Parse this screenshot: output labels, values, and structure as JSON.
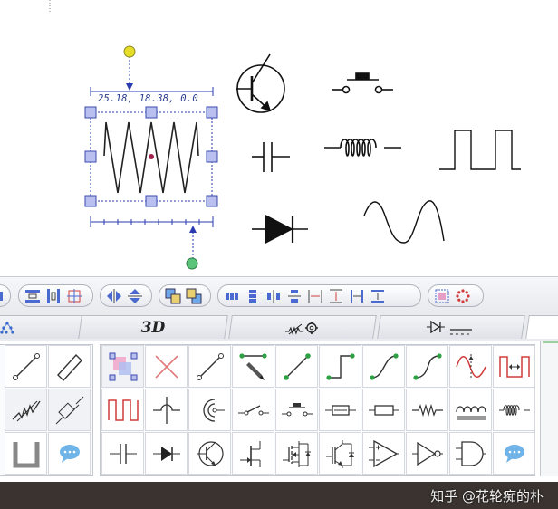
{
  "canvas": {
    "coordinate_readout": "25.18, 18.38, 0.0"
  },
  "tabs": [
    {
      "label": "",
      "icon": "tree-icon"
    },
    {
      "label": "3D",
      "icon": ""
    },
    {
      "label": "",
      "icon": "resistor-gear-icon"
    },
    {
      "label": "",
      "icon": "diode-dcsource-icon"
    }
  ],
  "watermark": "知乎 @花轮痴的朴",
  "colors": {
    "handle_fill": "#b9c0f0",
    "handle_stroke": "#3a4ab0",
    "rotate_handle": "#e6dd2a",
    "scale_handle": "#5cc47a",
    "accent_green": "#2ea043",
    "accent_red": "#d93a3a",
    "status_bar": "#3a332f"
  }
}
